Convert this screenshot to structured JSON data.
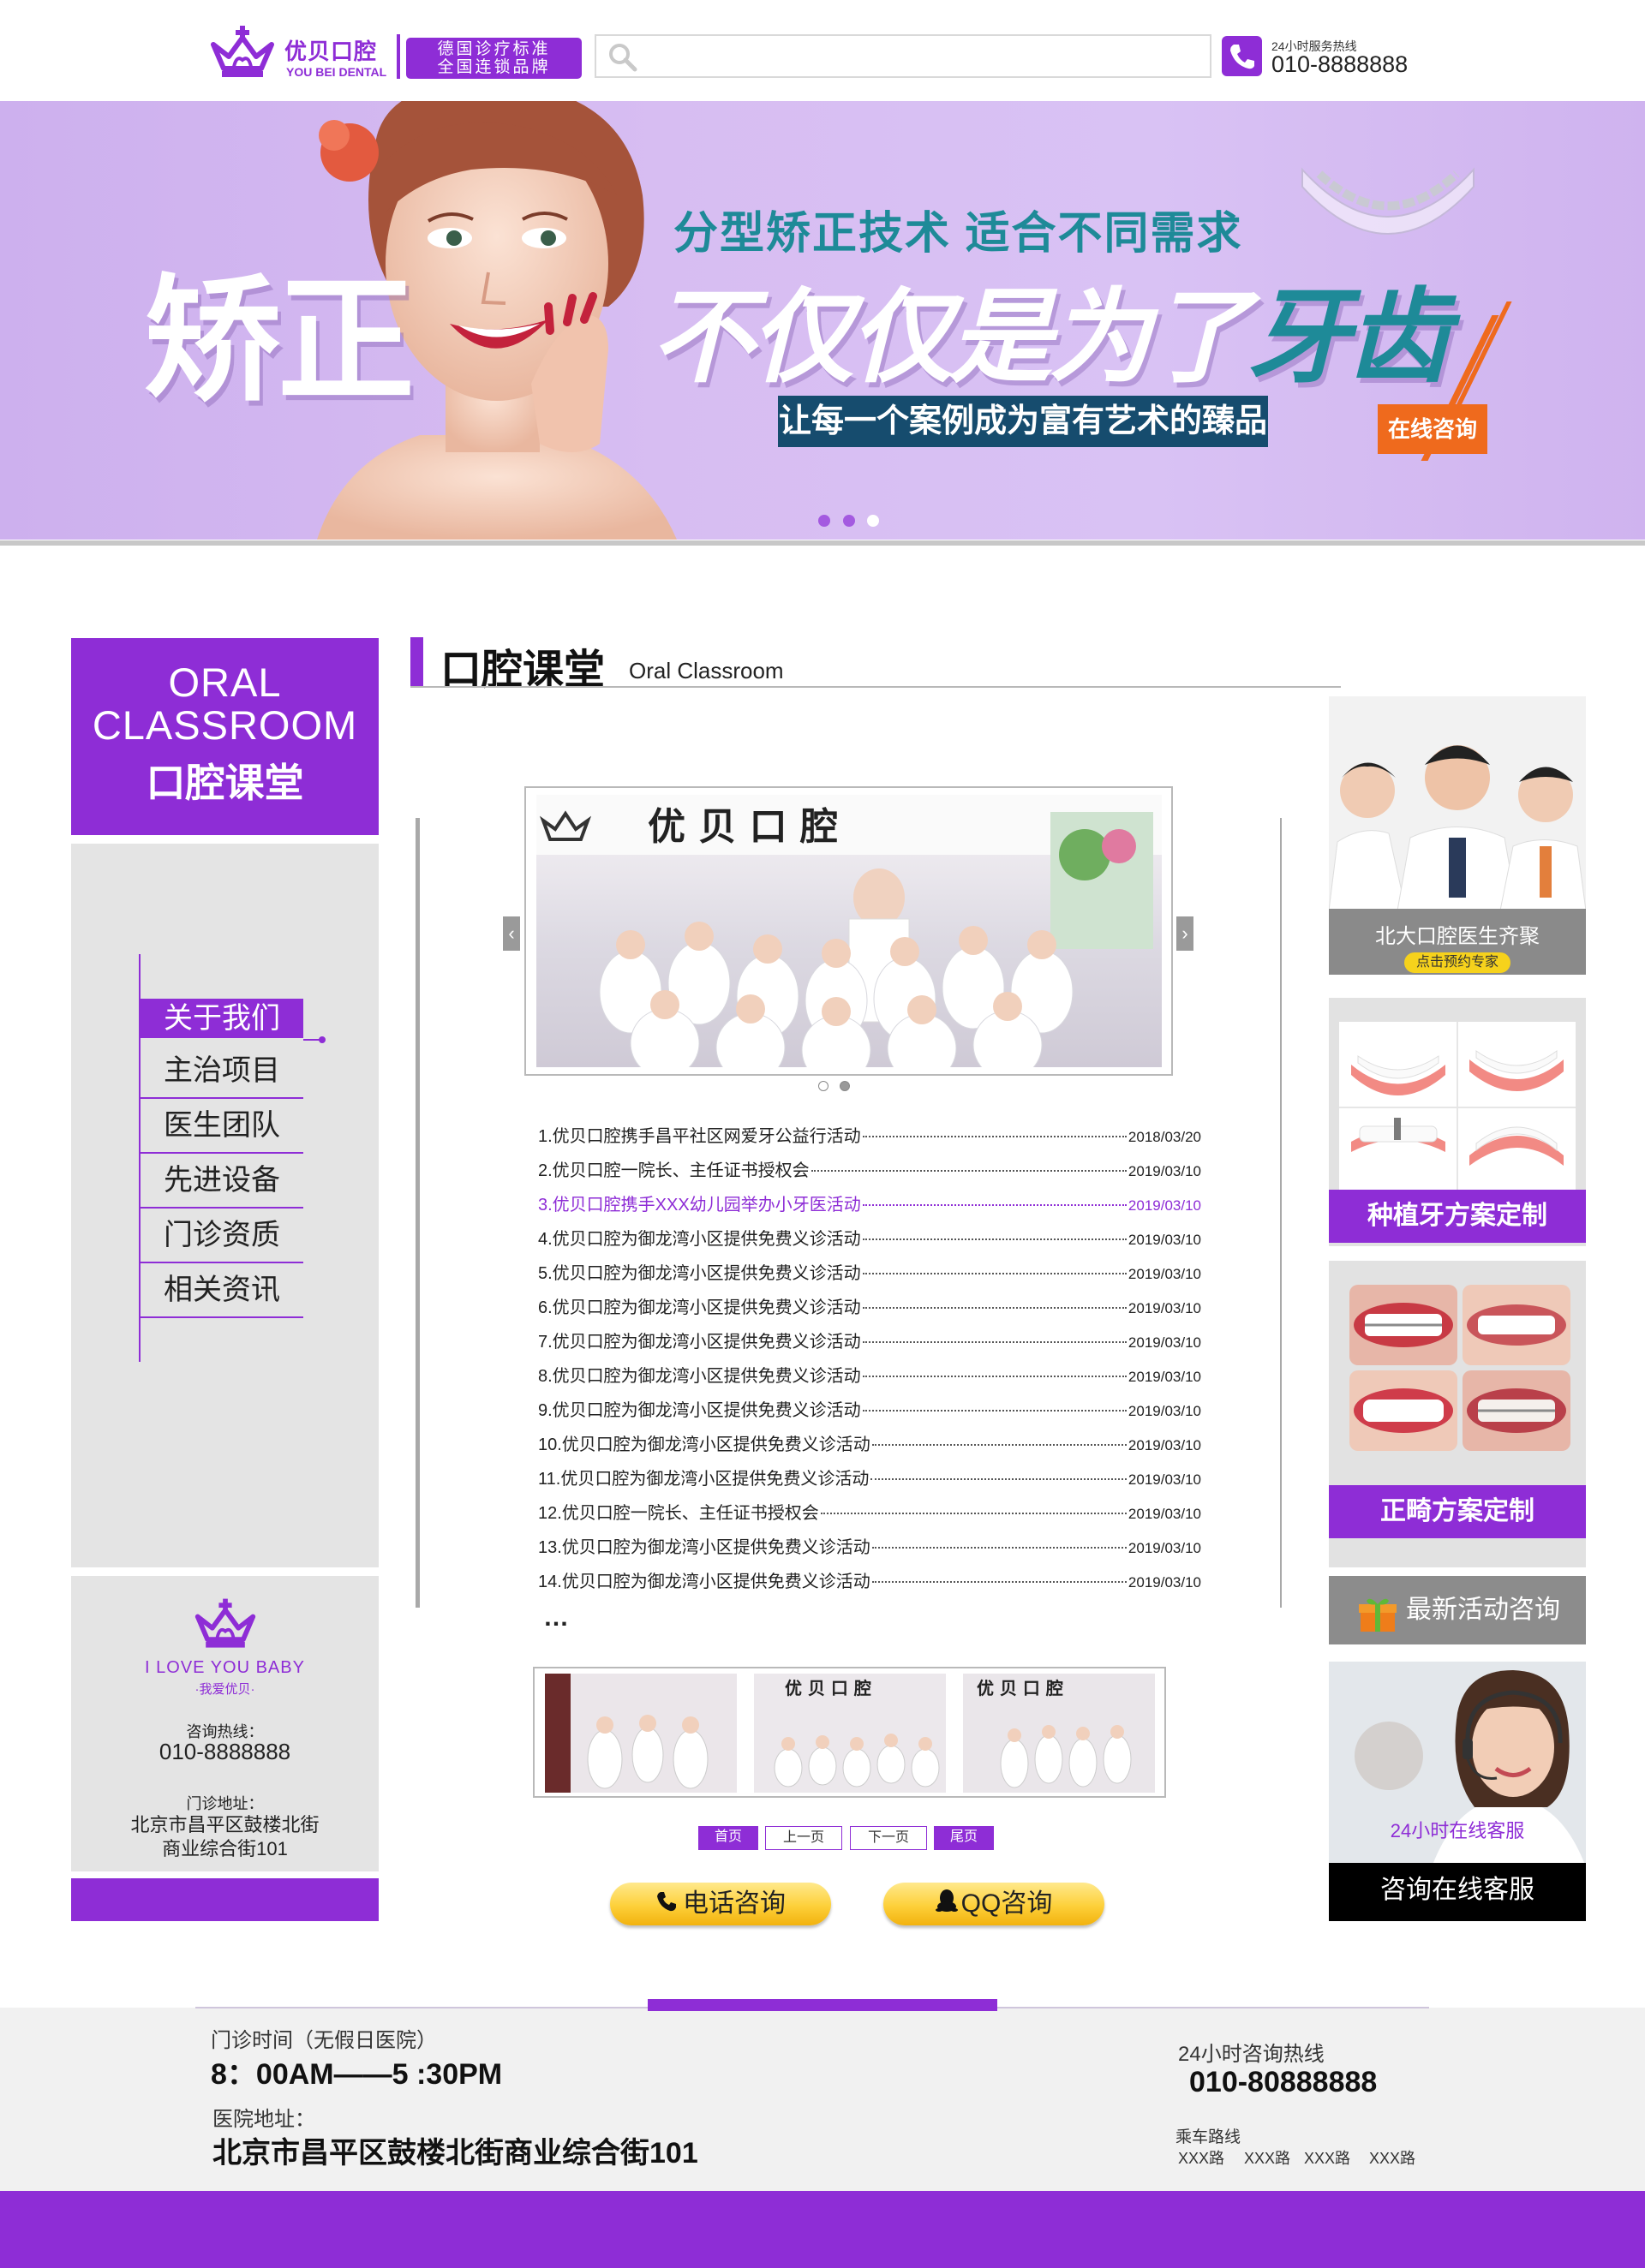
{
  "header": {
    "logo_cn": "优贝口腔",
    "logo_en": "YOU BEI DENTAL",
    "slogan_line1": "德国诊疗标准",
    "slogan_line2": "全国连锁品牌",
    "search_placeholder": "",
    "hotline_label": "24小时服务热线",
    "hotline_number": "010-8888888"
  },
  "banner": {
    "headline_left": "矫正",
    "subheadline": "分型矫正技术  适合不同需求",
    "headline_right_a": "不仅仅是为了",
    "headline_right_b": "牙齿",
    "strip_text": "让每一个案例成为富有艺术的臻品",
    "cta_label": "在线咨询",
    "slides": 3,
    "active_slide": 3
  },
  "sidebar": {
    "title_en_1": "ORAL",
    "title_en_2": "CLASSROOM",
    "title_cn": "口腔课堂",
    "menu": [
      {
        "label": "关于我们",
        "active": true
      },
      {
        "label": "主治项目",
        "active": false
      },
      {
        "label": "医生团队",
        "active": false
      },
      {
        "label": "先进设备",
        "active": false
      },
      {
        "label": "门诊资质",
        "active": false
      },
      {
        "label": "相关资讯",
        "active": false
      }
    ],
    "contact": {
      "love_text": "I LOVE YOU BABY",
      "love_sub": "·我爱优贝·",
      "phone_label": "咨询热线：",
      "phone": "010-8888888",
      "addr_label": "门诊地址：",
      "addr_line1": "北京市昌平区鼓楼北街",
      "addr_line2": "商业综合街101"
    }
  },
  "main": {
    "title_cn": "口腔课堂",
    "title_en": "Oral Classroom",
    "gallery": {
      "photo_sign": "优 贝 口 腔",
      "prev": "‹",
      "next": "›",
      "slides": 2,
      "active_slide": 2
    },
    "news": [
      {
        "title": "1.优贝口腔携手昌平社区网爱牙公益行活动",
        "date": "2018/03/20",
        "highlight": false
      },
      {
        "title": "2.优贝口腔一院长、主任证书授权会",
        "date": "2019/03/10",
        "highlight": false
      },
      {
        "title": "3.优贝口腔携手XXX幼儿园举办小牙医活动",
        "date": "2019/03/10",
        "highlight": true
      },
      {
        "title": "4.优贝口腔为御龙湾小区提供免费义诊活动",
        "date": "2019/03/10",
        "highlight": false
      },
      {
        "title": "5.优贝口腔为御龙湾小区提供免费义诊活动",
        "date": "2019/03/10",
        "highlight": false
      },
      {
        "title": "6.优贝口腔为御龙湾小区提供免费义诊活动",
        "date": "2019/03/10",
        "highlight": false
      },
      {
        "title": "7.优贝口腔为御龙湾小区提供免费义诊活动",
        "date": "2019/03/10",
        "highlight": false
      },
      {
        "title": "8.优贝口腔为御龙湾小区提供免费义诊活动",
        "date": "2019/03/10",
        "highlight": false
      },
      {
        "title": "9.优贝口腔为御龙湾小区提供免费义诊活动",
        "date": "2019/03/10",
        "highlight": false
      },
      {
        "title": "10.优贝口腔为御龙湾小区提供免费义诊活动",
        "date": "2019/03/10",
        "highlight": false
      },
      {
        "title": "11.优贝口腔为御龙湾小区提供免费义诊活动",
        "date": "2019/03/10",
        "highlight": false
      },
      {
        "title": "12.优贝口腔一院长、主任证书授权会",
        "date": "2019/03/10",
        "highlight": false
      },
      {
        "title": "13.优贝口腔为御龙湾小区提供免费义诊活动",
        "date": "2019/03/10",
        "highlight": false
      },
      {
        "title": "14.优贝口腔为御龙湾小区提供免费义诊活动",
        "date": "2019/03/10",
        "highlight": false
      }
    ],
    "more": "…",
    "thumb_sign": "优 贝 口 腔",
    "pager": {
      "first": "首页",
      "prev": "上一页",
      "next": "下一页",
      "last": "尾页"
    },
    "phone_btn": "电话咨询",
    "qq_btn": "QQ咨询"
  },
  "right": {
    "doctors_caption": "北大口腔医生齐聚",
    "doctors_badge": "点击预约专家",
    "implant_caption": "种植牙方案定制",
    "ortho_caption": "正畸方案定制",
    "activity_label": "最新活动咨询",
    "cs_caption": "24小时在线客服",
    "cs_button": "咨询在线客服"
  },
  "footer": {
    "hours_label": "门诊时间（无假日医院）",
    "hours_value": "8：00AM——5 :30PM",
    "address_label": "医院地址：",
    "address_value": "北京市昌平区鼓楼北街商业综合街101",
    "hotline_label": "24小时咨询热线",
    "hotline_value": "010-80888888",
    "route_label": "乘车路线",
    "routes": [
      "XXX路",
      "XXX路",
      "XXX路",
      "XXX路"
    ]
  },
  "colors": {
    "brand": "#8e2dd6",
    "teal": "#1e8a98",
    "orange": "#ef6a1d",
    "banner_bg": "#d7bdf2"
  }
}
